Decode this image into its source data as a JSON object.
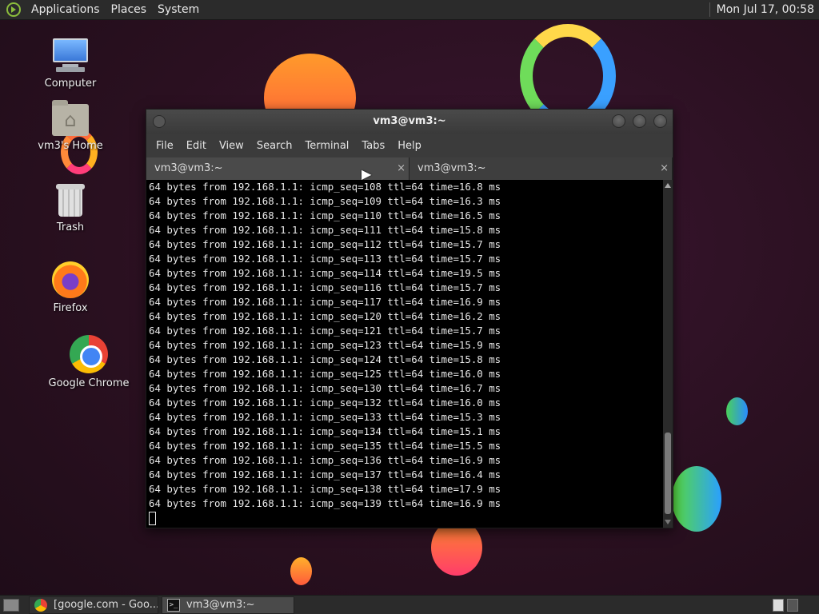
{
  "top_panel": {
    "menus": [
      "Applications",
      "Places",
      "System"
    ],
    "clock": "Mon Jul 17, 00:58"
  },
  "desktop_icons": {
    "computer": "Computer",
    "home": "vm3's Home",
    "trash": "Trash",
    "firefox": "Firefox",
    "chrome": "Google Chrome"
  },
  "terminal": {
    "title": "vm3@vm3:~",
    "menus": [
      "File",
      "Edit",
      "View",
      "Search",
      "Terminal",
      "Tabs",
      "Help"
    ],
    "tabs": [
      {
        "label": "vm3@vm3:~",
        "close": "×"
      },
      {
        "label": "vm3@vm3:~",
        "close": "×"
      }
    ],
    "output": [
      "64 bytes from 192.168.1.1: icmp_seq=108 ttl=64 time=16.8 ms",
      "64 bytes from 192.168.1.1: icmp_seq=109 ttl=64 time=16.3 ms",
      "64 bytes from 192.168.1.1: icmp_seq=110 ttl=64 time=16.5 ms",
      "64 bytes from 192.168.1.1: icmp_seq=111 ttl=64 time=15.8 ms",
      "64 bytes from 192.168.1.1: icmp_seq=112 ttl=64 time=15.7 ms",
      "64 bytes from 192.168.1.1: icmp_seq=113 ttl=64 time=15.7 ms",
      "64 bytes from 192.168.1.1: icmp_seq=114 ttl=64 time=19.5 ms",
      "64 bytes from 192.168.1.1: icmp_seq=116 ttl=64 time=15.7 ms",
      "64 bytes from 192.168.1.1: icmp_seq=117 ttl=64 time=16.9 ms",
      "64 bytes from 192.168.1.1: icmp_seq=120 ttl=64 time=16.2 ms",
      "64 bytes from 192.168.1.1: icmp_seq=121 ttl=64 time=15.7 ms",
      "64 bytes from 192.168.1.1: icmp_seq=123 ttl=64 time=15.9 ms",
      "64 bytes from 192.168.1.1: icmp_seq=124 ttl=64 time=15.8 ms",
      "64 bytes from 192.168.1.1: icmp_seq=125 ttl=64 time=16.0 ms",
      "64 bytes from 192.168.1.1: icmp_seq=130 ttl=64 time=16.7 ms",
      "64 bytes from 192.168.1.1: icmp_seq=132 ttl=64 time=16.0 ms",
      "64 bytes from 192.168.1.1: icmp_seq=133 ttl=64 time=15.3 ms",
      "64 bytes from 192.168.1.1: icmp_seq=134 ttl=64 time=15.1 ms",
      "64 bytes from 192.168.1.1: icmp_seq=135 ttl=64 time=15.5 ms",
      "64 bytes from 192.168.1.1: icmp_seq=136 ttl=64 time=16.9 ms",
      "64 bytes from 192.168.1.1: icmp_seq=137 ttl=64 time=16.4 ms",
      "64 bytes from 192.168.1.1: icmp_seq=138 ttl=64 time=17.9 ms",
      "64 bytes from 192.168.1.1: icmp_seq=139 ttl=64 time=16.9 ms"
    ]
  },
  "taskbar": {
    "tasks": [
      {
        "label": "[google.com - Goo...",
        "icon": "chrome-icon"
      },
      {
        "label": "vm3@vm3:~",
        "icon": "terminal-icon"
      }
    ]
  },
  "colors": {
    "desktop_bg": "#2a1020",
    "panel_bg": "#2b2b2b",
    "terminal_bg": "#000000",
    "terminal_fg": "#e8e8e8"
  }
}
